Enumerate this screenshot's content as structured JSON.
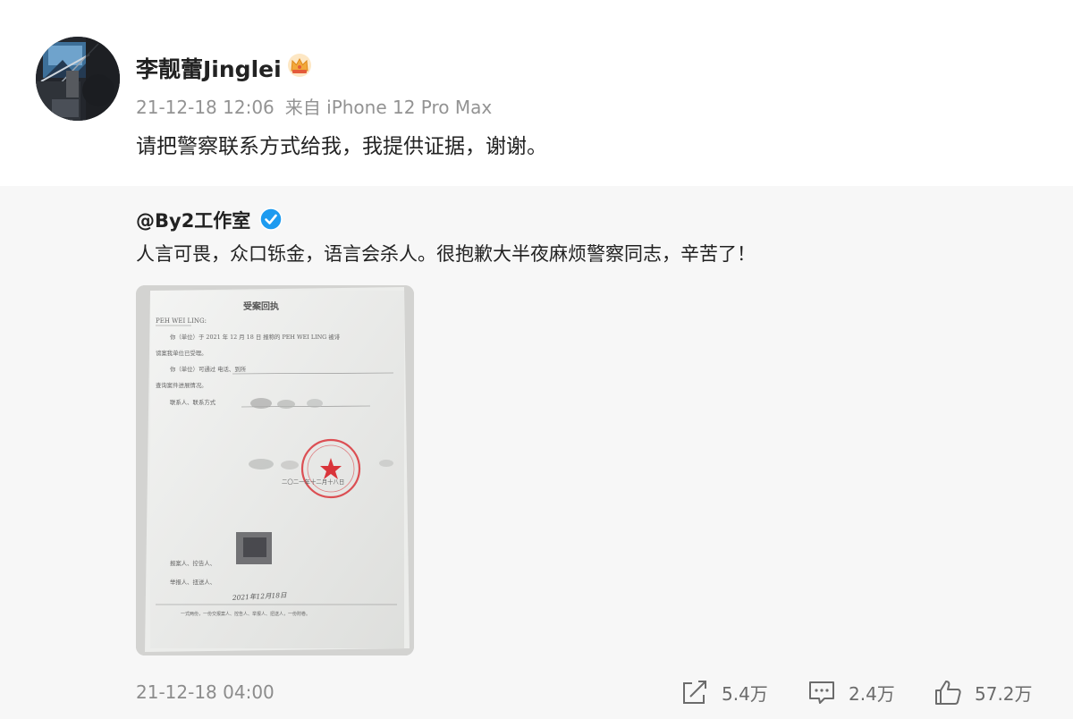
{
  "post": {
    "username": "李靓蕾Jinglei",
    "badge_icon": "crown-icon",
    "time": "21-12-18 12:06",
    "source": "来自 iPhone 12 Pro Max",
    "text": "请把警察联系方式给我，我提供证据，谢谢。"
  },
  "repost": {
    "author": "@By2工作室",
    "verified_icon": "verified-icon",
    "text": "人言可畏，众口铄金，语言会杀人。很抱歉大半夜麻烦警察同志，辛苦了！",
    "image": {
      "title": "受案回执",
      "name": "PEH WEI LING:",
      "line1": "你（单位）于 2021 年 12 月 18 日 报称的 PEH WEI LING 被诽",
      "line2": "谤案我单位已受理。",
      "line3": "你（单位）可通过  电话、到所",
      "line4": "查询案件进展情况。",
      "line5": "联系人、联系方式",
      "date_line": "二〇二一年十二月十八日",
      "sig1": "报案人、控告人、",
      "sig2": "举报人、扭送人、",
      "handwritten_date": "2021年12月18日",
      "footer": "一式两份，一份交报案人、控告人、举报人、扭送人，一份附卷。"
    },
    "time": "21-12-18 04:00",
    "actions": {
      "share_count": "5.4万",
      "comment_count": "2.4万",
      "like_count": "57.2万"
    }
  },
  "colors": {
    "accent_verified": "#1d9bf0",
    "crown": "#f2a83b",
    "stamp": "#d9343a"
  }
}
